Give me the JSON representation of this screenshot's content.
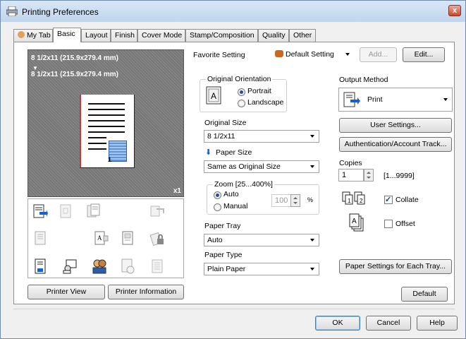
{
  "window": {
    "title": "Printing Preferences",
    "close_label": "x"
  },
  "tabs": [
    {
      "label": "My Tab"
    },
    {
      "label": "Basic"
    },
    {
      "label": "Layout"
    },
    {
      "label": "Finish"
    },
    {
      "label": "Cover Mode"
    },
    {
      "label": "Stamp/Composition"
    },
    {
      "label": "Quality"
    },
    {
      "label": "Other"
    }
  ],
  "preview": {
    "line1": "8 1/2x11 (215.9x279.4 mm)",
    "line2": "8 1/2x11 (215.9x279.4 mm)",
    "copies_badge": "x1",
    "page_number": "1"
  },
  "left_buttons": {
    "printer_view": "Printer View",
    "printer_information": "Printer Information"
  },
  "favorite": {
    "label": "Favorite Setting",
    "value": "Default Setting",
    "add": "Add...",
    "edit": "Edit..."
  },
  "orientation": {
    "title": "Original Orientation",
    "portrait": "Portrait",
    "landscape": "Landscape",
    "selected": "Portrait"
  },
  "original_size": {
    "label": "Original Size",
    "value": "8 1/2x11"
  },
  "paper_size": {
    "label": "Paper Size",
    "value": "Same as Original Size"
  },
  "zoom": {
    "title": "Zoom [25...400%]",
    "auto": "Auto",
    "manual": "Manual",
    "value": "100",
    "unit": "%"
  },
  "paper_tray": {
    "label": "Paper Tray",
    "value": "Auto"
  },
  "paper_type": {
    "label": "Paper Type",
    "value": "Plain Paper"
  },
  "output": {
    "label": "Output Method",
    "value": "Print"
  },
  "user_settings": "User Settings...",
  "auth": "Authentication/Account Track...",
  "copies": {
    "label": "Copies",
    "value": "1",
    "range": "[1...9999]"
  },
  "collate": {
    "label": "Collate",
    "checked": true
  },
  "offset": {
    "label": "Offset",
    "checked": false
  },
  "paper_settings": "Paper Settings for Each Tray...",
  "default_btn": "Default",
  "footer": {
    "ok": "OK",
    "cancel": "Cancel",
    "help": "Help"
  }
}
